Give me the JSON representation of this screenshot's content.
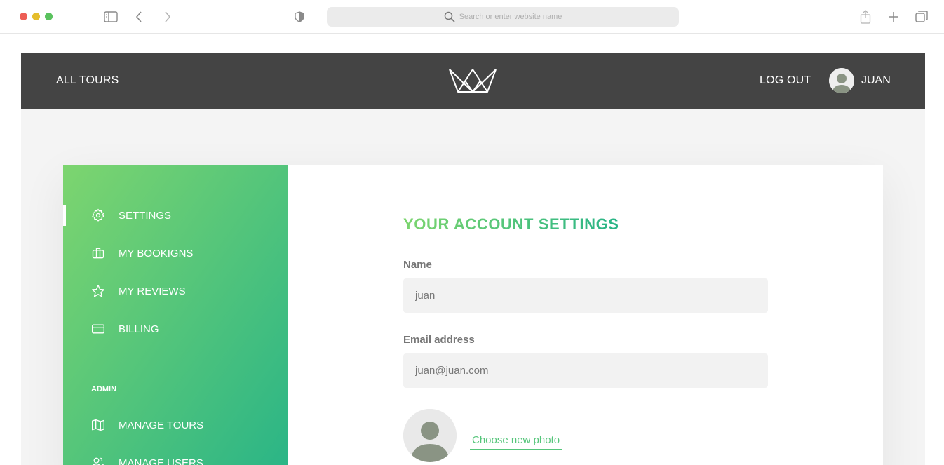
{
  "browser": {
    "url_placeholder": "Search or enter website name",
    "icons": [
      "sidebar-toggle-icon",
      "back-icon",
      "forward-icon",
      "privacy-shield-icon",
      "search-icon",
      "share-icon",
      "new-tab-icon",
      "tabs-overview-icon"
    ]
  },
  "nav": {
    "all_tours": "All Tours",
    "logout": "Log out",
    "username": "Juan",
    "logo_icon": "crown-logo-icon"
  },
  "sidebar": {
    "items": [
      {
        "label": "Settings",
        "icon": "settings-gear-icon",
        "active": true
      },
      {
        "label": "My bookigns",
        "icon": "briefcase-icon"
      },
      {
        "label": "My reviews",
        "icon": "star-icon"
      },
      {
        "label": "Billing",
        "icon": "credit-card-icon"
      }
    ],
    "admin_heading": "Admin",
    "admin_items": [
      {
        "label": "Manage tours",
        "icon": "map-icon"
      },
      {
        "label": "Manage users",
        "icon": "users-icon"
      }
    ]
  },
  "account": {
    "heading": "Your account settings",
    "name_label": "Name",
    "name_value": "juan",
    "email_label": "Email address",
    "email_value": "juan@juan.com",
    "photo_link": "Choose new photo"
  },
  "colors": {
    "accent_light": "#7dd56f",
    "accent_dark": "#28b487",
    "nav_bg": "#444444"
  }
}
